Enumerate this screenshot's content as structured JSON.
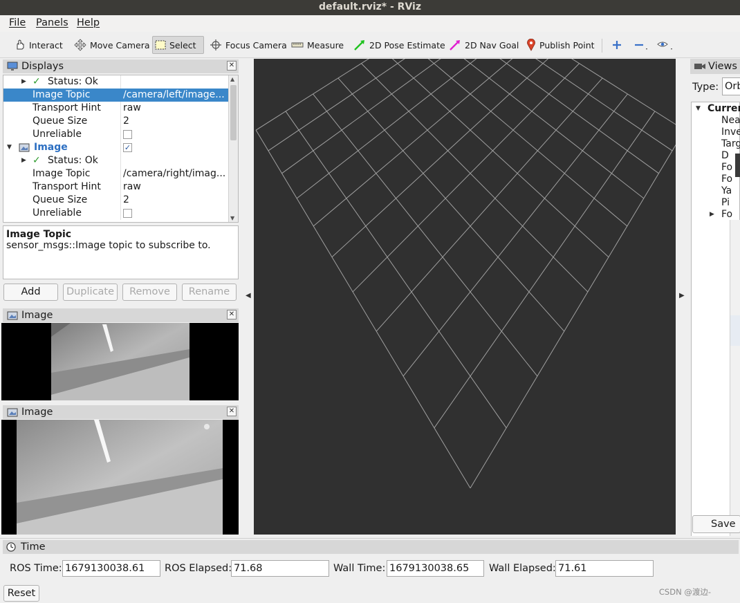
{
  "window": {
    "title": "default.rviz* - RViz"
  },
  "menu": {
    "items": [
      "File",
      "Panels",
      "Help"
    ]
  },
  "toolbar": {
    "interact": "Interact",
    "move_camera": "Move Camera",
    "select": "Select",
    "focus_camera": "Focus Camera",
    "measure": "Measure",
    "pose_estimate": "2D Pose Estimate",
    "nav_goal": "2D Nav Goal",
    "publish_point": "Publish Point"
  },
  "displays": {
    "title": "Displays",
    "rows": {
      "status1": {
        "label": "Status: Ok"
      },
      "image_topic1": {
        "label": "Image Topic",
        "value": "/camera/left/image..."
      },
      "transport1": {
        "label": "Transport Hint",
        "value": "raw"
      },
      "queue1": {
        "label": "Queue Size",
        "value": "2"
      },
      "unreliable1": {
        "label": "Unreliable"
      },
      "image": {
        "label": "Image"
      },
      "status2": {
        "label": "Status: Ok"
      },
      "image_topic2": {
        "label": "Image Topic",
        "value": "/camera/right/imag..."
      },
      "transport2": {
        "label": "Transport Hint",
        "value": "raw"
      },
      "queue2": {
        "label": "Queue Size",
        "value": "2"
      },
      "unreliable2": {
        "label": "Unreliable"
      }
    },
    "description": {
      "title": "Image Topic",
      "text": "sensor_msgs::Image topic to subscribe to."
    },
    "buttons": {
      "add": "Add",
      "duplicate": "Duplicate",
      "remove": "Remove",
      "rename": "Rename"
    }
  },
  "image_panels": {
    "left_title": "Image",
    "right_title": "Image"
  },
  "views": {
    "title": "Views",
    "type_label": "Type:",
    "type_value": "Orb",
    "current": "Curren",
    "items": [
      "Nea",
      "Inve",
      "Targ",
      "D",
      "Fo",
      "Fo",
      "Ya",
      "Pi",
      "Fo"
    ],
    "save": "Save"
  },
  "time": {
    "title": "Time",
    "ros_time_label": "ROS Time:",
    "ros_time": "1679130038.61",
    "ros_elapsed_label": "ROS Elapsed:",
    "ros_elapsed": "71.68",
    "wall_time_label": "Wall Time:",
    "wall_time": "1679130038.65",
    "wall_elapsed_label": "Wall Elapsed:",
    "wall_elapsed": "71.61",
    "reset": "Reset"
  },
  "watermark": "CSDN @渡边-",
  "colors": {
    "selection": "#3a87c9",
    "viewport": "#303030",
    "grid": "#a0a0a0"
  }
}
